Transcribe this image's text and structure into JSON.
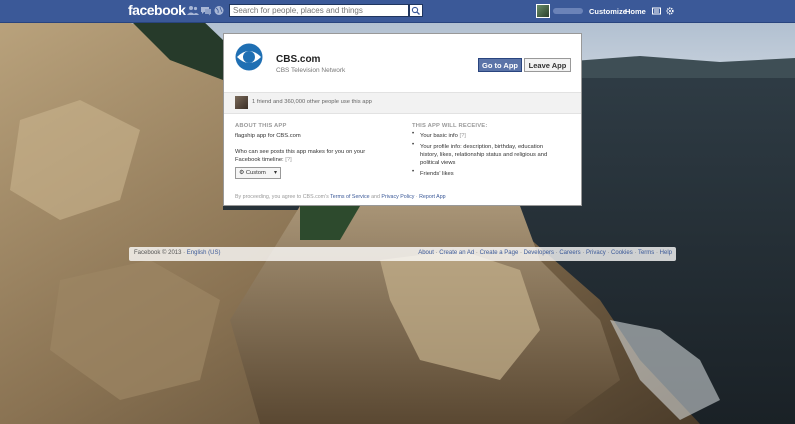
{
  "header": {
    "logo": "facebook",
    "search_placeholder": "Search for people, places and things",
    "customize_label": "Customize",
    "home_label": "Home"
  },
  "app": {
    "name": "CBS.com",
    "organization": "CBS Television Network",
    "go_button": "Go to App",
    "leave_button": "Leave App",
    "social_text": "1 friend and 360,000 other people use this app"
  },
  "about": {
    "title": "ABOUT THIS APP",
    "description": "flagship app for CBS.com",
    "visibility_line1": "Who can see posts this app makes for you on your",
    "visibility_line2": "Facebook timeline:",
    "help_mark": "[?]",
    "privacy_value": "Custom"
  },
  "receive": {
    "title": "THIS APP WILL RECEIVE:",
    "items": [
      "Your basic info",
      "Your profile info: description, birthday, education",
      "history, likes, relationship status and religious and",
      "political views",
      "Friends' likes"
    ],
    "help_mark": "[?]"
  },
  "consent": {
    "prefix": "By proceeding, you agree to CBS.com's",
    "terms": "Terms of Service",
    "and": "and",
    "privacy": "Privacy Policy",
    "dot": " · ",
    "report": "Report App"
  },
  "footer": {
    "copyright": "Facebook © 2013 ·",
    "language": "English (US)",
    "links": [
      "About",
      "Create an Ad",
      "Create a Page",
      "Developers",
      "Careers",
      "Privacy",
      "Cookies",
      "Terms",
      "Help"
    ]
  },
  "colors": {
    "brand": "#3b5998",
    "button_primary": "#5b74a8",
    "cbs_blue": "#1f6fb3"
  },
  "icons": {
    "friend_requests": "friends-icon",
    "messages": "messages-icon",
    "notifications": "globe-icon",
    "search": "search-icon",
    "privacy_setting": "gear-icon",
    "caret": "chevron-down-icon"
  }
}
